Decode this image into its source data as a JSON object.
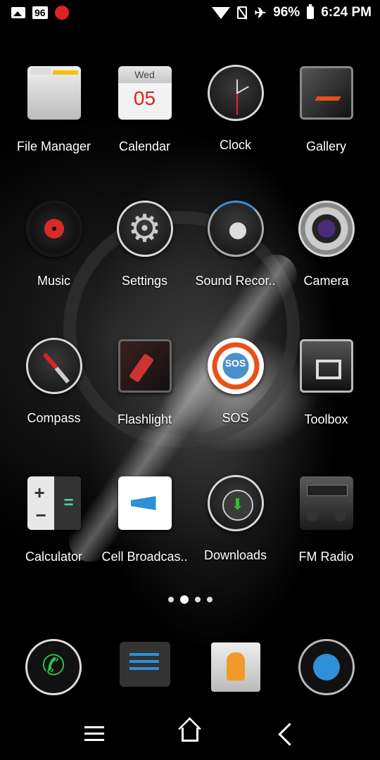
{
  "status_bar": {
    "left_icons": [
      "image-icon",
      "badge-96",
      "bug-icon"
    ],
    "badge_text": "96",
    "battery_percent": "96%",
    "time": "6:24 PM"
  },
  "apps": [
    {
      "label": "File Manager",
      "icon": "folder-icon"
    },
    {
      "label": "Calendar",
      "icon": "calendar-icon",
      "day": "Wed",
      "date": "05"
    },
    {
      "label": "Clock",
      "icon": "clock-icon"
    },
    {
      "label": "Gallery",
      "icon": "gallery-icon"
    },
    {
      "label": "Music",
      "icon": "vinyl-record-icon"
    },
    {
      "label": "Settings",
      "icon": "gear-icon"
    },
    {
      "label": "Sound Recor..",
      "icon": "microphone-icon"
    },
    {
      "label": "Camera",
      "icon": "camera-lens-icon"
    },
    {
      "label": "Compass",
      "icon": "compass-icon"
    },
    {
      "label": "Flashlight",
      "icon": "flashlight-icon"
    },
    {
      "label": "SOS",
      "icon": "lifebuoy-icon",
      "icon_text": "SOS"
    },
    {
      "label": "Toolbox",
      "icon": "toolbox-icon"
    },
    {
      "label": "Calculator",
      "icon": "calculator-icon"
    },
    {
      "label": "Cell Broadcas..",
      "icon": "megaphone-icon"
    },
    {
      "label": "Downloads",
      "icon": "download-arrow-icon"
    },
    {
      "label": "FM Radio",
      "icon": "radio-icon"
    }
  ],
  "page_indicator": {
    "pages": 4,
    "active": 2
  },
  "dock": [
    "phone-icon",
    "messages-icon",
    "contacts-icon",
    "browser-globe-icon"
  ],
  "navbar": [
    "menu-icon",
    "home-icon",
    "back-icon"
  ],
  "colors": {
    "background": "#000000",
    "accent_red": "#d9231c",
    "accent_blue": "#2f8fd8",
    "accent_green": "#2fbf4f"
  }
}
